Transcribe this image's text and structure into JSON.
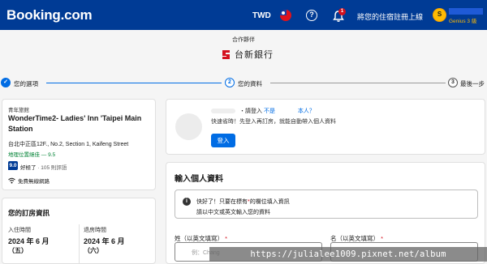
{
  "header": {
    "logo": "Booking.com",
    "currency": "TWD",
    "notification_count": "1",
    "list_property": "將您的住宿註冊上線",
    "avatar_letter": "S",
    "genius_level": "Genius 3 級",
    "colors": {
      "bar": "#003b95",
      "accent": "#febb02"
    }
  },
  "partner": {
    "label": "合作夥伴",
    "name": "台新銀行",
    "brand_color": "#d4111e"
  },
  "steps": [
    {
      "number": "✓",
      "label": "您的選項",
      "state": "done"
    },
    {
      "number": "2",
      "label": "您的資料",
      "state": "active"
    },
    {
      "number": "3",
      "label": "最後一步",
      "state": "todo"
    }
  ],
  "hotel": {
    "type": "青年旅館",
    "name": "WonderTime2- Ladies' Inn 'Taipei Main Station",
    "address": "台北中正區12F., No.2, Section 1, Kaifeng Street",
    "location_score": "地理位置絕佳 — 9.5",
    "score": "9.0",
    "rating_word": "好極了",
    "review_count": "· 105 則評語",
    "amenity": "免費無線網路"
  },
  "booking_details": {
    "title": "您的訂房資訊",
    "checkin_label": "入住時間",
    "checkout_label": "退房時間",
    "checkin_date": "2024 年 6 月",
    "checkout_date": "2024 年 6 月",
    "checkin_day": "（五）",
    "checkout_day": "（六）"
  },
  "signin": {
    "prompt": "・請登入",
    "not_you": "不是",
    "yourself": "本人？",
    "subtext": "快速省時！先登入再訂房，就能自動帶入個人資料",
    "button": "登入"
  },
  "form": {
    "title": "輸入個人資料",
    "alert_line1_a": "快好了！只要在標有",
    "alert_line1_star": "*",
    "alert_line1_b": "的欄位填入資訊",
    "alert_line2": "請以中文或英文輸入您的資料",
    "last_name_label": "姓（以英文填寫）",
    "first_name_label": "名（以英文填寫）",
    "required_mark": "*",
    "last_name_placeholder": "例：Chang",
    "first_name_placeholder": ""
  },
  "watermark": "https://julialee1009.pixnet.net/album"
}
